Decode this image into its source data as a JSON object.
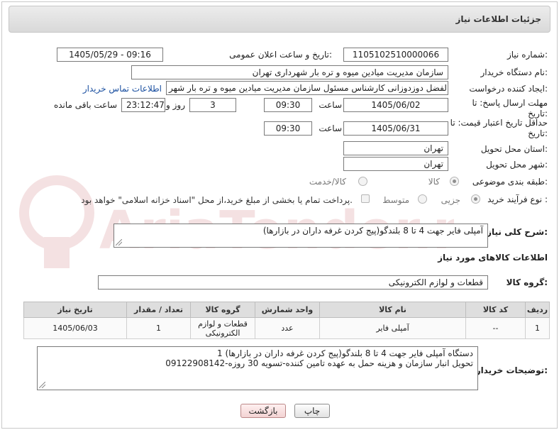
{
  "header": {
    "title": "جزئیات اطلاعات نیاز"
  },
  "fields": {
    "need_number_label": "شماره نیاز:",
    "need_number": "1105102510000066",
    "announce_label": "تاریخ و ساعت اعلان عمومی:",
    "announce_value": "1405/05/29 - 09:16",
    "buyer_org_label": "نام دستگاه خریدار:",
    "buyer_org": "سازمان مدیریت میادین میوه و تره بار شهرداری تهران",
    "creator_label": "ایجاد کننده درخواست:",
    "creator": "ابوالفضل دوزدوزانی کارشناس مسئول سازمان مدیریت میادین میوه و تره بار شهر",
    "contact_link": "اطلاعات تماس خریدار",
    "reply_deadline_label": "مهلت ارسال پاسخ: تا تاریخ:",
    "reply_date": "1405/06/02",
    "time_label": "ساعت",
    "reply_time": "09:30",
    "days": "3",
    "days_label": "روز و",
    "remaining": "23:12:47",
    "remaining_label": "ساعت باقی مانده",
    "price_deadline_label": "حداقل تاریخ اعتبار قیمت: تا تاریخ:",
    "price_date": "1405/06/31",
    "price_time": "09:30",
    "province_label": "استان محل تحویل:",
    "province": "تهران",
    "city_label": "شهر محل تحویل:",
    "city": "تهران",
    "category_label": "طبقه بندی موضوعی:",
    "category_options": [
      "کالا",
      "کالا/خدمت"
    ],
    "process_label": "نوع فرآیند خرید :",
    "process_options": [
      "جزیی",
      "متوسط"
    ],
    "payment_note": "پرداخت تمام یا بخشی از مبلغ خرید،از محل \"اسناد خزانه اسلامی\" خواهد بود."
  },
  "summary": {
    "label": "شرح کلی نیاز:",
    "text": "آمپلی فایر جهت 4 تا 8 بلندگو(پیج کردن غرفه داران در بازارها)"
  },
  "goods": {
    "section_title": "اطلاعات کالاهای مورد نیاز",
    "group_label": "گروه کالا:",
    "group_value": "قطعات و لوازم الکترونیکی"
  },
  "table": {
    "headers": [
      "ردیف",
      "کد کالا",
      "نام کالا",
      "واحد شمارش",
      "گروه کالا",
      "تعداد / مقدار",
      "تاریخ نیاز"
    ],
    "rows": [
      {
        "row": "1",
        "code": "--",
        "name": "آمپلی فایر",
        "unit": "عدد",
        "group": "قطعات و لوازم الکترونیکی",
        "qty": "1",
        "date": "1405/06/03"
      }
    ]
  },
  "buyer_notes": {
    "label": "توضیحات خریدار:",
    "line1": "1 دستگاه آمپلی فایر جهت 4 تا 8 بلندگو(پیج کردن غرفه داران در بازارها)",
    "line2": "تحویل انبار سازمان و هزینه حمل به عهده تامین کننده-تسویه 30 روزه-09122908142"
  },
  "buttons": {
    "print": "چاپ",
    "back": "بازگشت"
  },
  "watermark": {
    "text": "AriaTender.neT"
  },
  "colors": {
    "link": "#1a4fa0",
    "header_bg": "#dedede"
  }
}
